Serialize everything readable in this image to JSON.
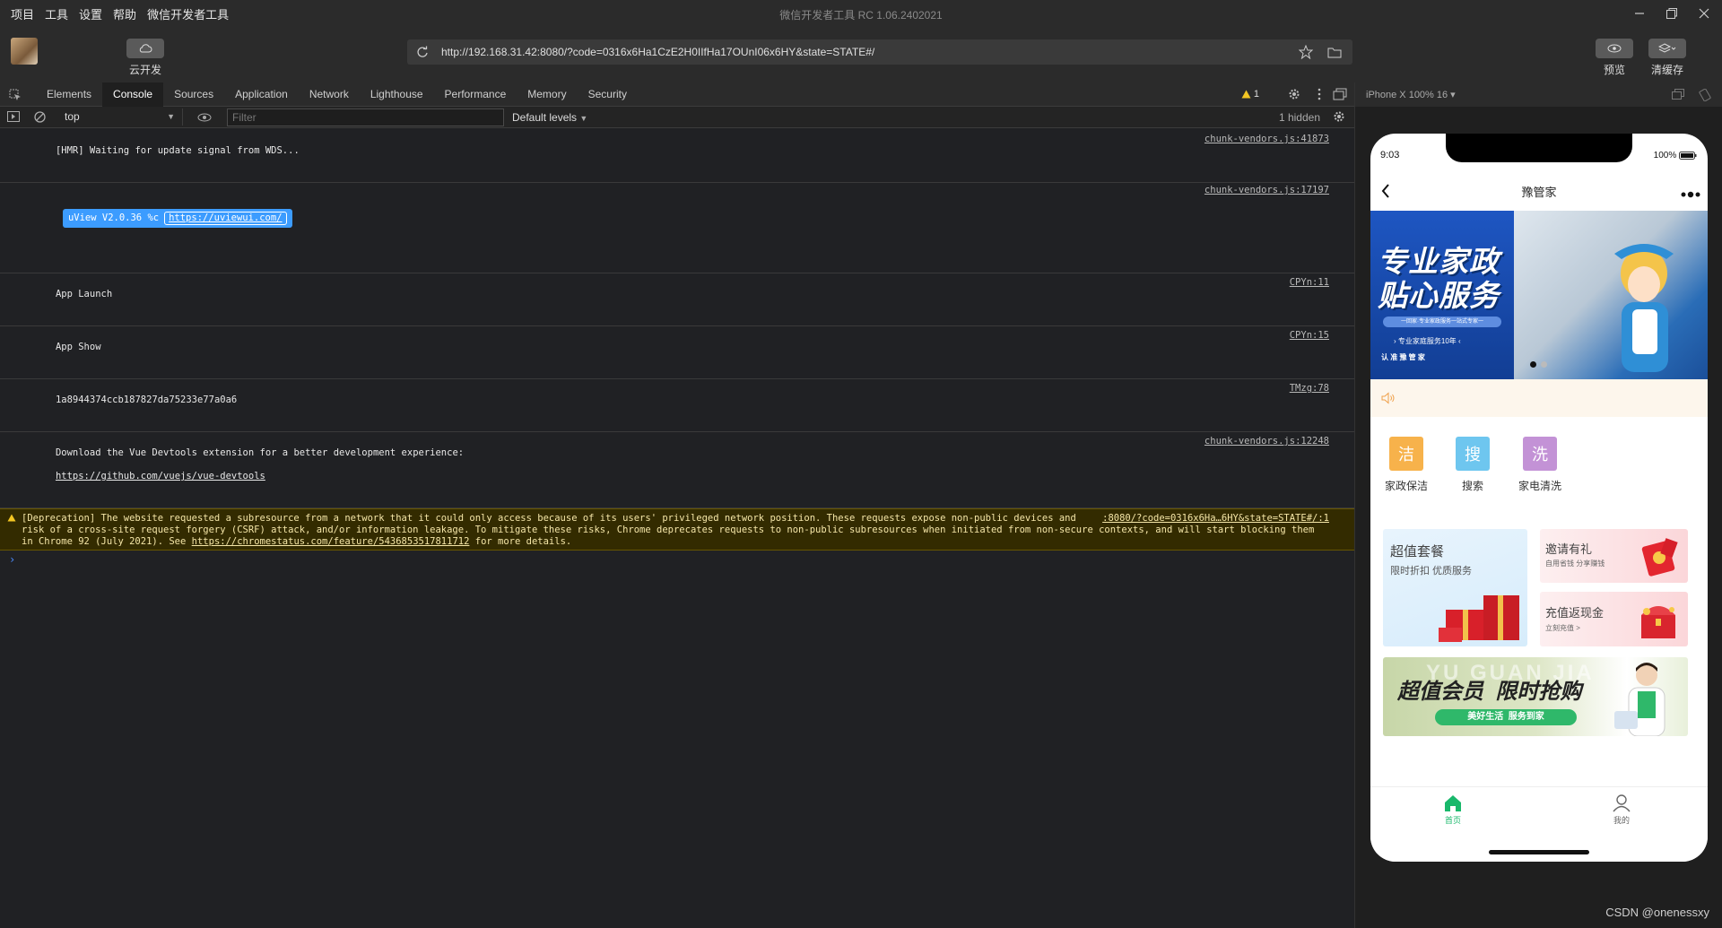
{
  "menu": [
    "项目",
    "工具",
    "设置",
    "帮助",
    "微信开发者工具"
  ],
  "window_title": "微信开发者工具 RC 1.06.2402021",
  "toolbar": {
    "cloud_label": "云开发",
    "url": "http://192.168.31.42:8080/?code=0316x6Ha1CzE2H0IIfHa17OUnI06x6HY&state=STATE#/",
    "preview_label": "预览",
    "clear_cache_label": "清缓存"
  },
  "devtools": {
    "tabs": [
      "Elements",
      "Console",
      "Sources",
      "Application",
      "Network",
      "Lighthouse",
      "Performance",
      "Memory",
      "Security"
    ],
    "active_tab": "Console",
    "warning_count": "1",
    "context": "top",
    "filter_placeholder": "Filter",
    "levels": "Default levels",
    "hidden": "1 hidden"
  },
  "console": {
    "hmr": {
      "text": "[HMR] Waiting for update signal from WDS...",
      "src": "chunk-vendors.js:41873"
    },
    "uview": {
      "label": "uView V2.0.36 %c",
      "link": "https://uviewui.com/",
      "src": "chunk-vendors.js:17197"
    },
    "launch": {
      "text": "App Launch",
      "src": "CPYn:11"
    },
    "show": {
      "text": "App Show",
      "src": "CPYn:15"
    },
    "hash": {
      "text": "1a8944374ccb187827da75233e77a0a6",
      "src": "TMzg:78"
    },
    "devtools_msg": {
      "text": "Download the Vue Devtools extension for a better development experience:",
      "link": "https://github.com/vuejs/vue-devtools",
      "src": "chunk-vendors.js:12248"
    },
    "warning": {
      "text": "[Deprecation] The website requested a subresource from a network that it could only access because of its users' privileged network position. These requests expose non-public devices and servers to the internet, increasing the risk of a cross-site request forgery (CSRF) attack, and/or information leakage. To mitigate these risks, Chrome deprecates requests to non-public subresources when initiated from non-secure contexts, and will start blocking them in Chrome 92 (July 2021). See",
      "link": "https://chromestatus.com/feature/5436853517811712",
      "tail": "for more details.",
      "src": ":8080/?code=0316x6Ha…6HY&state=STATE#/:1"
    },
    "prompt": "›"
  },
  "simulator": {
    "device": "iPhone X 100% 16 ▾",
    "time": "9:03",
    "battery": "100%",
    "nav_title": "豫管家",
    "banner_title1": "专业家政",
    "banner_title2": "贴心服务",
    "banner_sub": "一回家·专业家政服务一站式专家一",
    "banner_sub2": "› 专业家庭服务10年 ‹",
    "banner_tags": "认  准  豫  管  家",
    "grid": [
      {
        "icon": "洁",
        "label": "家政保洁",
        "color": "#f7b24b"
      },
      {
        "icon": "搜",
        "label": "搜索",
        "color": "#6ec6ef"
      },
      {
        "icon": "洗",
        "label": "家电清洗",
        "color": "#c392d6"
      }
    ],
    "card1": {
      "title": "超值套餐",
      "sub": "限时折扣  优质服务"
    },
    "card2": {
      "title": "邀请有礼",
      "sub": "自用省钱  分享赚钱"
    },
    "card3": {
      "title": "充值返现金",
      "sub": "立刻充值 >"
    },
    "card4": {
      "title": "超值会员  限时抢购",
      "sub": "美好生活  服务到家",
      "bg_text": "YU GUAN JIA"
    },
    "tabs": [
      {
        "label": "首页",
        "active": true
      },
      {
        "label": "我的",
        "active": false
      }
    ]
  },
  "watermark": "CSDN @onenessxy"
}
